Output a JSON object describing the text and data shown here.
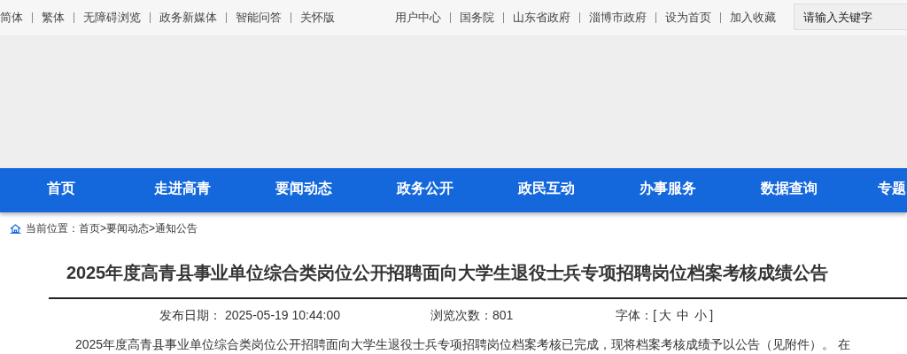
{
  "top_links_left": [
    "简体",
    "繁体",
    "无障碍浏览",
    "政务新媒体",
    "智能问答",
    "关怀版"
  ],
  "top_links_right": [
    "用户中心",
    "国务院",
    "山东省政府",
    "淄博市政府",
    "设为首页",
    "加入收藏"
  ],
  "search": {
    "placeholder": "请输入关键字"
  },
  "nav": [
    {
      "label": "首页"
    },
    {
      "label": "走进高青"
    },
    {
      "label": "要闻动态"
    },
    {
      "label": "政务公开"
    },
    {
      "label": "政民互动"
    },
    {
      "label": "办事服务"
    },
    {
      "label": "数据查询"
    },
    {
      "label": "专题"
    }
  ],
  "breadcrumb": {
    "label": "当前位置：",
    "items": [
      "首页",
      "要闻动态",
      "通知公告"
    ],
    "separator": ">"
  },
  "article": {
    "title": "2025年度高青县事业单位综合类岗位公开招聘面向大学生退役士兵专项招聘岗位档案考核成绩公告",
    "date_label": "发布日期：",
    "date": "2025-05-19 10:44:00",
    "views_label": "浏览次数：",
    "views": "801",
    "font_label": "字体：",
    "font_open": "[",
    "font_sizes": [
      "大",
      "中",
      "小"
    ],
    "font_close": "]",
    "body": "2025年度高青县事业单位综合类岗位公开招聘面向大学生退役士兵专项招聘岗位档案考核已完成，现将档案考核成绩予以公告（见附件）。 在"
  }
}
